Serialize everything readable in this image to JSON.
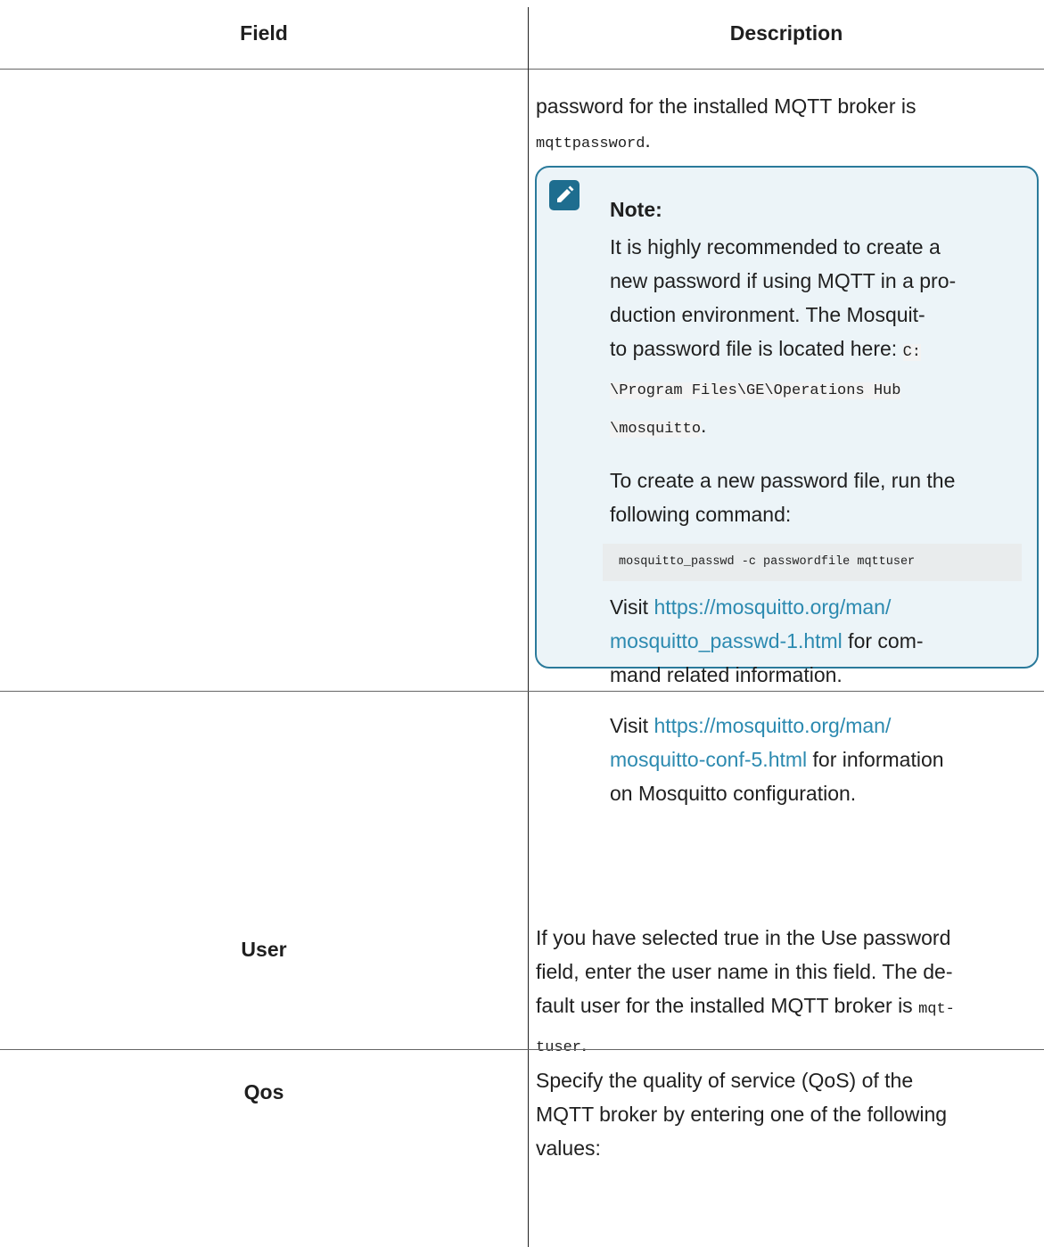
{
  "headers": {
    "field": "Field",
    "description": "Description"
  },
  "password_row": {
    "text_line1": "password for the installed MQTT broker is",
    "code_value": "mqttpassword",
    "period": "."
  },
  "note": {
    "title": "Note:",
    "icon": "pencil-note-icon",
    "p1_lines": [
      "It is highly recommended to create a",
      "new password if using MQTT in a pro-",
      "duction environment. The Mosquit-"
    ],
    "p1_line4_text": "to password file is located here: ",
    "p1_code_line4": "C:",
    "p1_code_line5": "\\Program Files\\GE\\Operations Hub",
    "p1_code_line6": "\\mosquitto",
    "p1_end": ".",
    "p2_lines": [
      "To create a new password file, run the",
      "following command:"
    ],
    "command": "mosquitto_passwd -c passwordfile mqttuser",
    "p3_visit": "Visit ",
    "p3_link_line1": "https://mosquitto.org/man/",
    "p3_link_line2": "mosquitto_passwd-1.html",
    "p3_after_link": " for com-",
    "p3_line3": "mand related information.",
    "p4_visit": "Visit ",
    "p4_link_line1": "https://mosquitto.org/man/",
    "p4_link_line2": "mosquitto-conf-5.html",
    "p4_after_link": " for information",
    "p4_line3": "on Mosquitto configuration."
  },
  "user_row": {
    "field": "User",
    "line1": "If you have selected true in the Use password",
    "line2": "field, enter the user name in this field. The de-",
    "line3_text": "fault user for the installed MQTT broker is ",
    "line3_code": "mqt-",
    "line4_code": "tuser",
    "line4_end": "."
  },
  "qos_row": {
    "field": "Qos",
    "line1": "Specify the quality of service (QoS) of the",
    "line2": "MQTT broker by entering one of the following",
    "line3": "values:"
  },
  "colors": {
    "note_border": "#2a7a9b",
    "note_background": "#ecf4f8",
    "link": "#2c8ab0"
  }
}
